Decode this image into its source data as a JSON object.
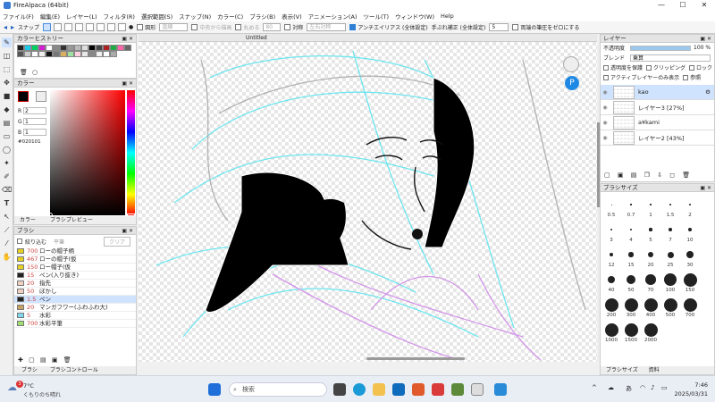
{
  "window": {
    "title": "FireAlpaca (64bit)",
    "controls": [
      "—",
      "☐",
      "✕"
    ]
  },
  "menu": [
    "ファイル(F)",
    "編集(E)",
    "レイヤー(L)",
    "フィルタ(R)",
    "選択範囲(S)",
    "スナップ(N)",
    "カラー(C)",
    "ブラシ(B)",
    "表示(V)",
    "アニメーション(A)",
    "ツール(T)",
    "ウィンドウ(W)",
    "Help"
  ],
  "toolbar": {
    "snap_label": "スナップ",
    "shape_label": "図形",
    "shape_value": "直線",
    "center_label": "中央から描画",
    "round_label": "丸める",
    "round_value": "80",
    "symmetry_label": "対称",
    "symmetry_value": "左右対称",
    "antialias_label": "アンチエイリアス (全体設定)",
    "stabilizer_label": "手ぶれ補正 (全体設定)",
    "stabilizer_value": "5",
    "pressure_label": "両端の筆圧をゼロにする"
  },
  "canvas_tab": "Untitled",
  "color_history": {
    "title": "カラーヒストリー",
    "colors": [
      "#222222",
      "#1ec8e8",
      "#00d060",
      "#d020d0",
      "#ffffff",
      "#888888",
      "#333333",
      "#999999",
      "#bbbbbb",
      "#dddddd",
      "#000000",
      "#444444",
      "#aa2222",
      "#22aa44",
      "#ff66aa",
      "#666666",
      "#555555",
      "#cccccc",
      "#ffffff",
      "#eeeeee",
      "#111111",
      "#777777",
      "#d8b060",
      "#a0e0a0",
      "#ffd0e0",
      "#e8e8e8",
      "#888888",
      "#f0f0f0",
      "#ffffff",
      "#aaaaaa"
    ]
  },
  "color_panel": {
    "title": "カラー",
    "r_label": "R",
    "r_value": "2",
    "g_label": "G",
    "g_value": "1",
    "b_label": "B",
    "b_value": "1",
    "hex": "#020101",
    "tabs": [
      "カラー",
      "ブラシプレビュー"
    ]
  },
  "brush_panel": {
    "title": "ブラシ",
    "filter_label": "絞り込む",
    "filter_placeholder": "平筆",
    "clear_label": "クリア",
    "items": [
      {
        "size": "700",
        "name": "ローの帽子柄",
        "color": "#e8d020"
      },
      {
        "size": "467",
        "name": "ローの帽子(仮",
        "color": "#e8d020"
      },
      {
        "size": "150",
        "name": "ロー帽子(仮",
        "color": "#e8d020"
      },
      {
        "size": "15",
        "name": "ペン(入り抜き)",
        "color": "#222222"
      },
      {
        "size": "20",
        "name": "指先",
        "color": "#f0d0c0"
      },
      {
        "size": "50",
        "name": "ぼかし",
        "color": "#f0d0c0"
      },
      {
        "size": "1.5",
        "name": "ペン",
        "color": "#222222"
      },
      {
        "size": "20",
        "name": "マンガフワー(ふわふわ大)",
        "color": "#c8a060"
      },
      {
        "size": "5",
        "name": "水彩",
        "color": "#80d8f0"
      },
      {
        "size": "700",
        "name": "水彩平筆",
        "color": "#a0e070"
      }
    ],
    "selected_index": 6,
    "tabs": [
      "ブラシ",
      "ブラシコントロール"
    ]
  },
  "layer_panel": {
    "title": "レイヤー",
    "opacity_label": "不透明度",
    "opacity_value": "100 %",
    "opacity_fraction": 1.0,
    "blend_label": "ブレンド",
    "blend_value": "乗算",
    "protect_label": "透明度を保護",
    "clipping_label": "クリッピング",
    "lock_label": "ロック",
    "active_only_label": "アクティブレイヤーのみ表示",
    "reference_label": "参照",
    "layers": [
      {
        "name": "kao",
        "selected": true
      },
      {
        "name": "レイヤー3 [27%]",
        "selected": false
      },
      {
        "name": "a¥kami",
        "selected": false
      },
      {
        "name": "レイヤー2 [43%]",
        "selected": false
      }
    ]
  },
  "brush_size_panel": {
    "title": "ブラシサイズ",
    "sizes": [
      "0.5",
      "0.7",
      "1",
      "1.5",
      "2",
      "3",
      "4",
      "5",
      "7",
      "10",
      "12",
      "15",
      "20",
      "25",
      "30",
      "40",
      "50",
      "70",
      "100",
      "150",
      "200",
      "300",
      "400",
      "500",
      "700",
      "1000",
      "1500",
      "2000"
    ],
    "tabs": [
      "ブラシサイズ",
      "資料"
    ]
  },
  "taskbar": {
    "weather_temp": "7°C",
    "weather_desc": "くもりのち晴れ",
    "badge": "3",
    "search_placeholder": "検索",
    "time": "7:46",
    "date": "2025/03/31",
    "ime": "あ",
    "tray_chevron": "^"
  }
}
